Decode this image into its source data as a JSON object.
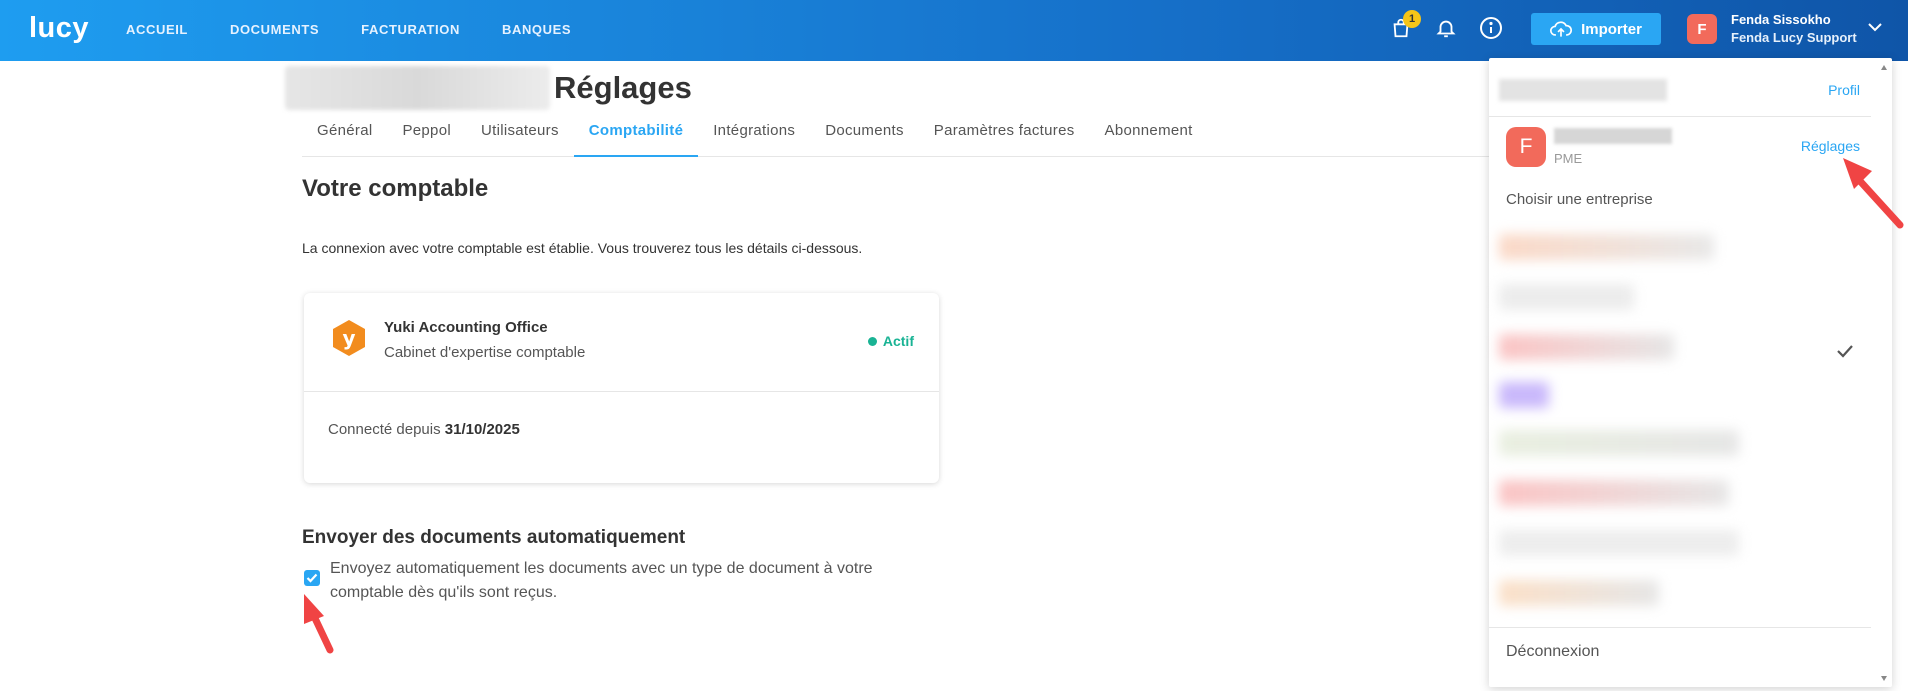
{
  "app": {
    "logo": "lucy"
  },
  "nav": {
    "items": [
      {
        "label": "ACCUEIL"
      },
      {
        "label": "DOCUMENTS"
      },
      {
        "label": "FACTURATION"
      },
      {
        "label": "BANQUES"
      }
    ]
  },
  "header": {
    "cart_badge": "1",
    "import_label": "Importer",
    "avatar_initial": "F",
    "user_name": "Fenda Sissokho",
    "user_org": "Fenda Lucy Support"
  },
  "page": {
    "title": "Réglages",
    "tabs": [
      {
        "label": "Général"
      },
      {
        "label": "Peppol"
      },
      {
        "label": "Utilisateurs"
      },
      {
        "label": "Comptabilité",
        "active": true
      },
      {
        "label": "Intégrations"
      },
      {
        "label": "Documents"
      },
      {
        "label": "Paramètres factures"
      },
      {
        "label": "Abonnement"
      }
    ],
    "section_title": "Votre comptable",
    "connection_text": "La connexion avec votre comptable est établie. Vous trouverez tous les détails ci-dessous.",
    "accountant": {
      "logo_letter": "y",
      "name": "Yuki Accounting Office",
      "type": "Cabinet d'expertise comptable",
      "status": "Actif",
      "connected_label": "Connecté depuis",
      "connected_date": "31/10/2025"
    },
    "auto_send": {
      "title": "Envoyer des documents automatiquement",
      "checked": true,
      "description": "Envoyez automatiquement les documents avec un type de document à votre comptable dès qu'ils sont reçus."
    }
  },
  "dropdown": {
    "profile_label": "Profil",
    "avatar_initial": "F",
    "company_type": "PME",
    "settings_label": "Réglages",
    "choose_company": "Choisir une entreprise",
    "logout": "Déconnexion"
  },
  "colors": {
    "accent": "#2aa6f3",
    "topbar_start": "#1e9df0",
    "topbar_end": "#0f55a8",
    "status_active": "#19b394",
    "avatar": "#f26a5b",
    "badge": "#f5c518",
    "yuki_orange": "#f28c1e",
    "annotation_arrow": "#f04444"
  },
  "icons": {
    "cart": "shopping-bag-icon",
    "bell": "bell-icon",
    "info": "info-icon",
    "upload": "cloud-upload-icon",
    "chevron": "chevron-down-icon",
    "check": "checkmark-icon"
  }
}
